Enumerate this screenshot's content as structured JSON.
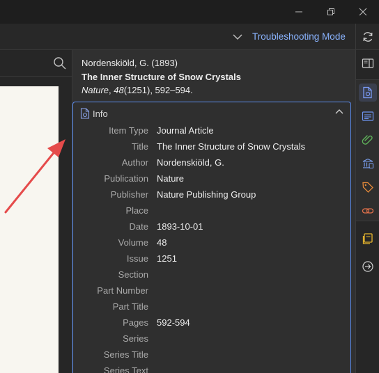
{
  "window": {
    "minimize_icon": "minimize-icon",
    "maximize_icon": "restore-icon",
    "close_icon": "close-icon"
  },
  "toolbar": {
    "mode_label": "Troubleshooting Mode",
    "sync_icon": "sync-icon"
  },
  "citation": {
    "line1": "Nordenskiöld, G. (1893)",
    "title": "The Inner Structure of Snow Crystals",
    "journal": "Nature",
    "volume": "48",
    "issue_pages": "(1251), 592–594."
  },
  "info_section": {
    "title": "Info",
    "fields": [
      {
        "label": "Item Type",
        "value": "Journal Article"
      },
      {
        "label": "Title",
        "value": "The Inner Structure of Snow Crystals"
      },
      {
        "label": "Author",
        "value": "Nordenskiöld, G."
      },
      {
        "label": "Publication",
        "value": "Nature"
      },
      {
        "label": "Publisher",
        "value": "Nature Publishing Group"
      },
      {
        "label": "Place",
        "value": ""
      },
      {
        "label": "Date",
        "value": "1893-10-01"
      },
      {
        "label": "Volume",
        "value": "48"
      },
      {
        "label": "Issue",
        "value": "1251"
      },
      {
        "label": "Section",
        "value": ""
      },
      {
        "label": "Part Number",
        "value": ""
      },
      {
        "label": "Part Title",
        "value": ""
      },
      {
        "label": "Pages",
        "value": "592-594"
      },
      {
        "label": "Series",
        "value": ""
      },
      {
        "label": "Series Title",
        "value": ""
      },
      {
        "label": "Series Text",
        "value": ""
      }
    ]
  },
  "colors": {
    "accent": "#5b8def",
    "link": "#8ab4ff",
    "annotation_arrow": "#e54b4b"
  }
}
